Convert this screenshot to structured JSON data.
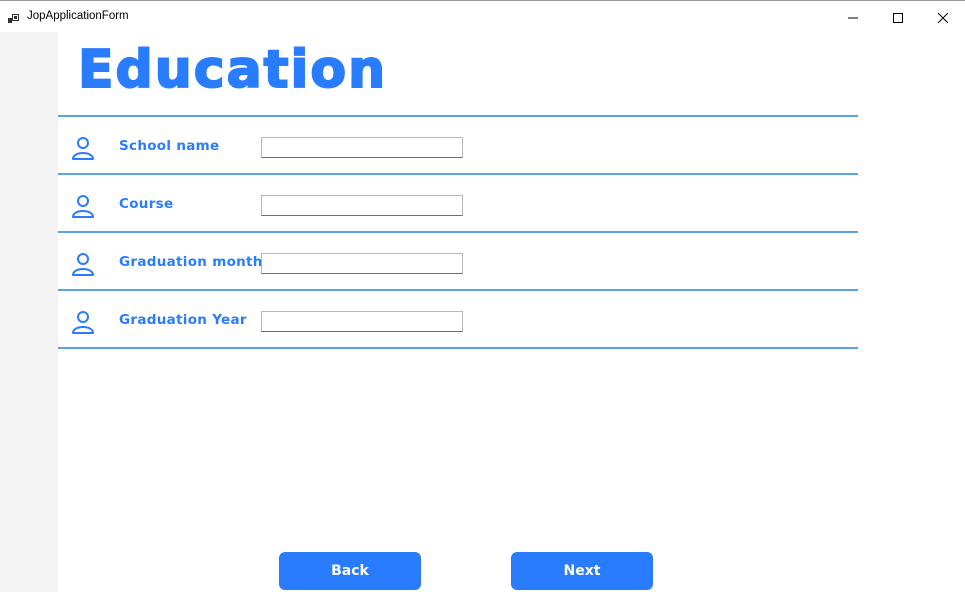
{
  "window": {
    "title": "JopApplicationForm",
    "controls": {
      "minimize": "minimize-icon",
      "maximize": "maximize-icon",
      "close": "close-icon"
    }
  },
  "colors": {
    "accent": "#2a7cff",
    "divider": "#5aa4e6",
    "sidebar": "#f3f3f3"
  },
  "form": {
    "heading": "Education",
    "fields": [
      {
        "label": "School name",
        "value": "",
        "icon": "user-icon"
      },
      {
        "label": "Course",
        "value": "",
        "icon": "user-icon"
      },
      {
        "label": "Graduation month",
        "value": "",
        "icon": "user-icon"
      },
      {
        "label": "Graduation Year",
        "value": "",
        "icon": "user-icon"
      }
    ]
  },
  "buttons": {
    "back": "Back",
    "next": "Next"
  }
}
